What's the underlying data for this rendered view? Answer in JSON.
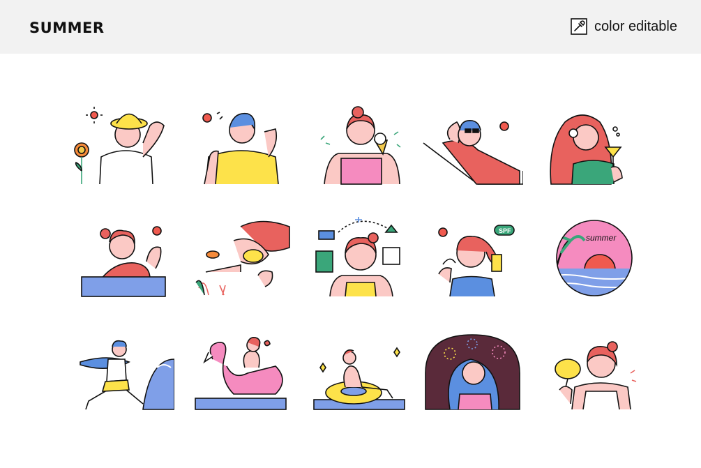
{
  "header": {
    "title": "SUMMER",
    "badge_label": "color editable",
    "badge_icon": "eyedropper-icon"
  },
  "palette": {
    "skin": "#fbc9c5",
    "hair_red": "#e8625e",
    "hair_blue": "#5b8fe0",
    "yellow": "#fde24a",
    "pink": "#f58bbf",
    "water": "#7f9fe8",
    "green": "#3aa67a",
    "outline": "#111111",
    "sun": "#f05a4f"
  },
  "illustrations": [
    {
      "name": "sunflower-girl-sticker"
    },
    {
      "name": "sweating-girl-sticker"
    },
    {
      "name": "ice-cream-girl-sticker"
    },
    {
      "name": "sunbathing-guy-sticker"
    },
    {
      "name": "cocktail-girl-sticker"
    },
    {
      "name": "swimming-girl-sticker"
    },
    {
      "name": "snorkeling-girl-sticker"
    },
    {
      "name": "travel-planning-girl-sticker"
    },
    {
      "name": "sunscreen-girl-sticker"
    },
    {
      "name": "summer-sunset-badge"
    },
    {
      "name": "surfer-guy-sticker"
    },
    {
      "name": "flamingo-float-girl-sticker"
    },
    {
      "name": "tube-float-girl-sticker"
    },
    {
      "name": "fireworks-girl-sticker"
    },
    {
      "name": "hand-fan-girl-sticker"
    }
  ],
  "badge_text": "summer",
  "spf_text": "SPF"
}
